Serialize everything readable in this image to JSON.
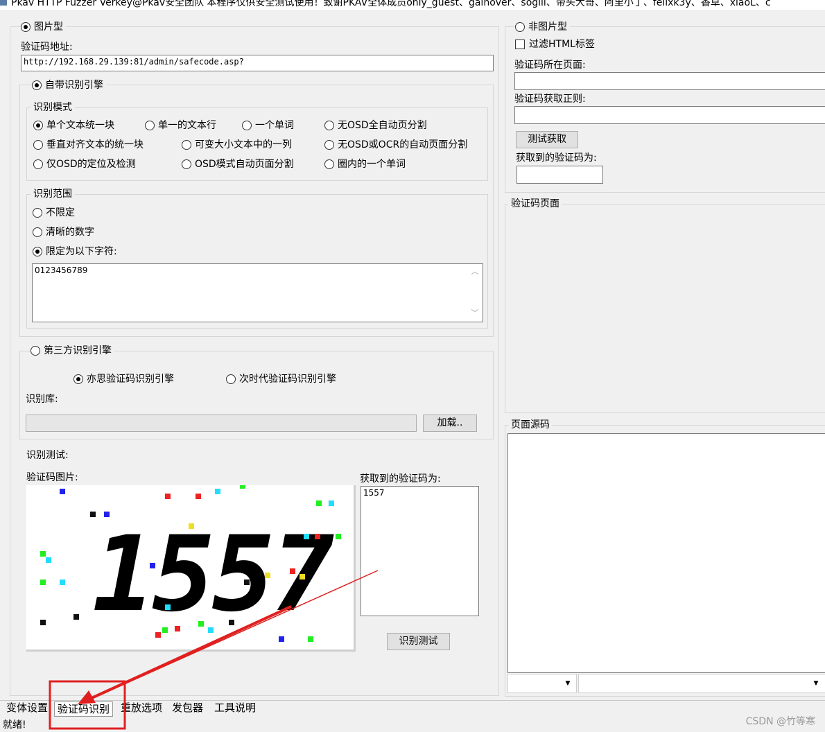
{
  "window": {
    "title": "Pkav HTTP Fuzzer   Verkey@Pkav安全团队 本程序仅供安全测试使用！致谢PKAV全体成员only_guest、gainover、sogili、带头大哥、阿里小丁、felixk3y、香草、xiaoL、c"
  },
  "left": {
    "image_type_radio": "图片型",
    "captcha_url_label": "验证码地址:",
    "captcha_url_value": "http://192.168.29.139:81/admin/safecode.asp?",
    "builtin_engine_radio": "自带识别引擎",
    "recognition_mode": {
      "legend": "识别模式",
      "options": [
        "单个文本统一块",
        "单一的文本行",
        "一个单词",
        "无OSD全自动页分割",
        "垂直对齐文本的统一块",
        "可变大小文本中的一列",
        "无OSD或OCR的自动页面分割",
        "仅OSD的定位及检测",
        "OSD模式自动页面分割",
        "圈内的一个单词"
      ],
      "selected": "单个文本统一块"
    },
    "recognition_range": {
      "legend": "识别范围",
      "options": [
        "不限定",
        "清晰的数字",
        "限定为以下字符:"
      ],
      "selected": "限定为以下字符:",
      "chars_value": "0123456789"
    },
    "third_party_radio": "第三方识别引擎",
    "third_party_options": [
      "亦思验证码识别引擎",
      "次时代验证码识别引擎"
    ],
    "third_party_selected": "亦思验证码识别引擎",
    "library_label": "识别库:",
    "library_value": "",
    "load_button": "加载..",
    "test_label": "识别测试:",
    "captcha_image_label": "验证码图片:",
    "captcha_image_text": "1557",
    "result_label": "获取到的验证码为:",
    "result_value": "1557",
    "test_button": "识别测试"
  },
  "right": {
    "non_image_radio": "非图片型",
    "filter_html_checkbox": "过滤HTML标签",
    "page_label": "验证码所在页面:",
    "page_value": "",
    "regex_label": "验证码获取正则:",
    "regex_value": "",
    "test_fetch_button": "测试获取",
    "fetched_label": "获取到的验证码为:",
    "fetched_value": "",
    "captcha_page_legend": "验证码页面",
    "page_source_legend": "页面源码"
  },
  "tabs": [
    "变体设置",
    "验证码识别",
    "重放选项",
    "发包器",
    "工具说明"
  ],
  "active_tab": "验证码识别",
  "status": "就绪!",
  "watermark": "CSDN @竹等寒",
  "colors": {
    "annotation_red": "#e02020",
    "window_bg": "#f0f0f0"
  }
}
